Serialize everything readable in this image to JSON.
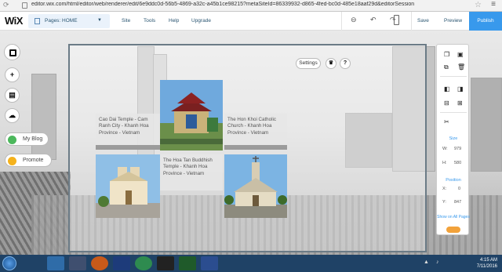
{
  "browser": {
    "url": "editor.wix.com/html/editor/web/renderer/edit/6e9ddc0d-56b5-4869-a32c-a45b1ce98215?metaSiteId=86339932-d865-4fed-bc0d-485e18aaf29d&editorSession"
  },
  "topbar": {
    "logo": "WiX",
    "pages_label": "Pages: HOME",
    "menu": [
      "Site",
      "Tools",
      "Help",
      "Upgrade"
    ],
    "save": "Save",
    "preview": "Preview",
    "publish": "Publish"
  },
  "left_tools": {
    "my_blog": "My Blog",
    "promote": "Promote"
  },
  "settings": {
    "label": "Settings",
    "help": "?"
  },
  "cards": [
    {
      "title": "Cao Dai Temple - Cam Ranh City - Khanh Hoa Province - Vietnam"
    },
    {
      "title": "The Hon Khoi Catholic Church - Khanh Hoa Province - Vietnam"
    },
    {
      "title": "The Hoa Tan Buddhish Temple - Khanh Hoa Province - Vietnam"
    }
  ],
  "inspector": {
    "size_label": "Size",
    "w_label": "W:",
    "w_value": "979",
    "h_label": "H:",
    "h_value": "580",
    "position_label": "Position",
    "x_label": "X:",
    "x_value": "0",
    "y_label": "Y:",
    "y_value": "847",
    "show_all": "Show on All Pages"
  },
  "taskbar": {
    "time": "4:15 AM",
    "date": "7/11/2016"
  },
  "colors": {
    "accent": "#3899ec",
    "taskbar": "#1f4266"
  }
}
